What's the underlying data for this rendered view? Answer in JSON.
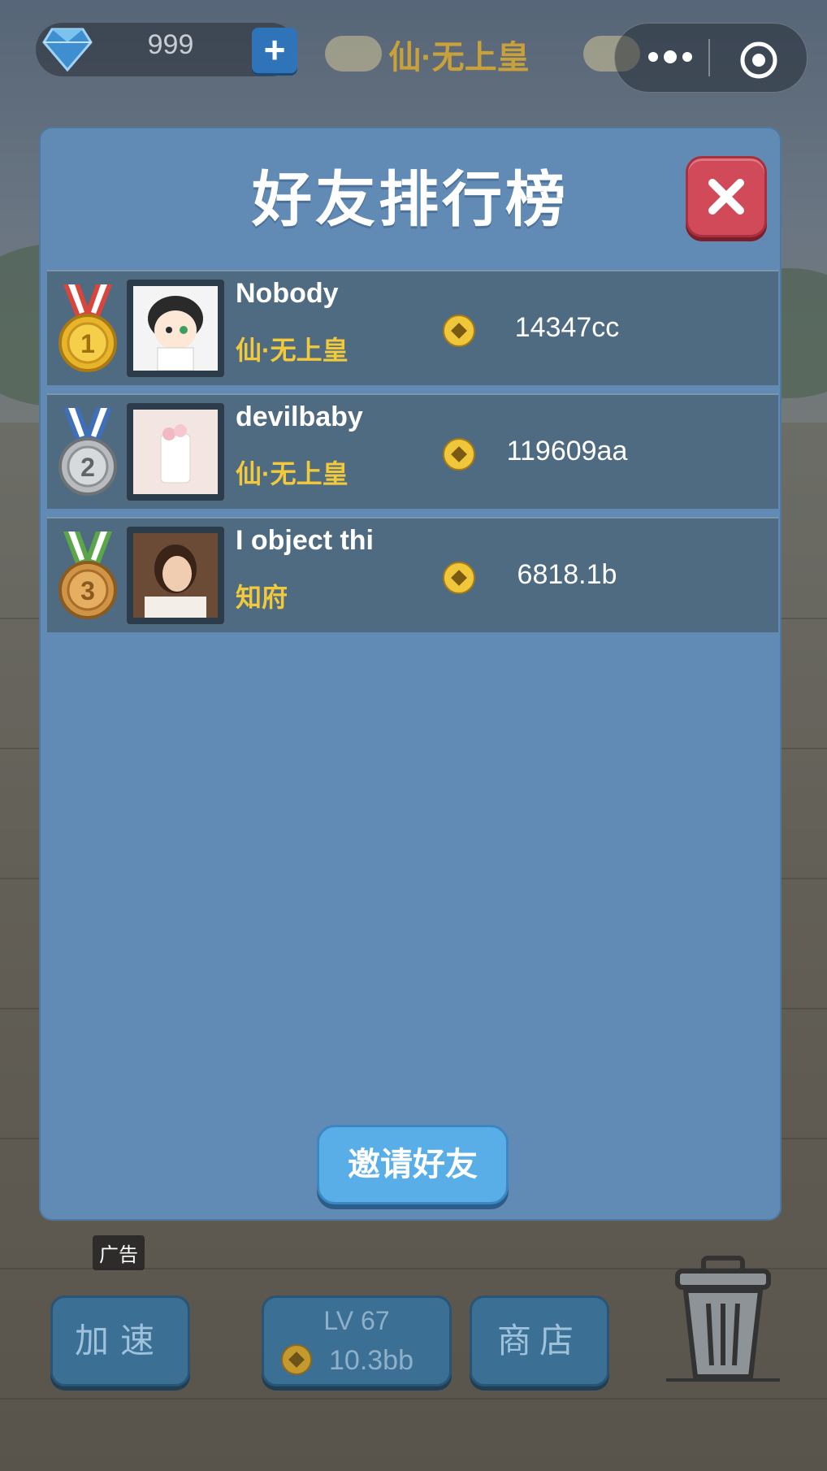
{
  "hud": {
    "gem_count": "999",
    "plus_label": "+",
    "rank_title": "仙·无上皇",
    "capsule_more": "•••",
    "gem_icon": "diamond-icon",
    "target_icon": "target-icon"
  },
  "modal": {
    "title": "好友排行榜",
    "close_icon": "close-icon",
    "invite_label": "邀请好友",
    "players": [
      {
        "position": "1",
        "name": "Nobody",
        "rank": "仙·无上皇",
        "score": "14347cc",
        "medal_color": "#d9453b"
      },
      {
        "position": "2",
        "name": "devilbaby",
        "rank": "仙·无上皇",
        "score": "119609aa",
        "medal_color": "#3f6fb8"
      },
      {
        "position": "3",
        "name": "I object thi",
        "rank": "知府",
        "score": "6818.1b",
        "medal_color": "#5aa648"
      }
    ]
  },
  "bottom": {
    "ad_tag": "广告",
    "speed_label": "加速",
    "level_label": "LV 67",
    "level_value": "10.3bb",
    "shop_label": "商店",
    "trash_icon": "trash-icon"
  }
}
